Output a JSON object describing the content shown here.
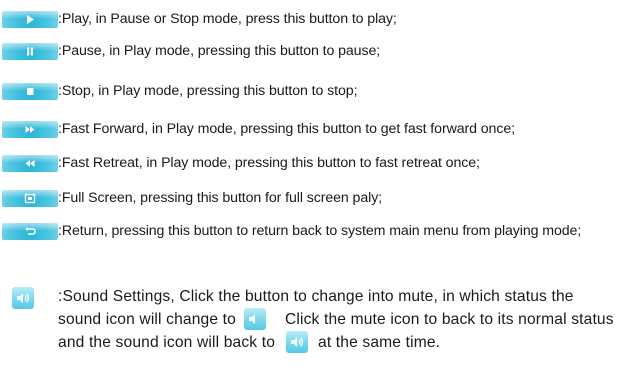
{
  "items": [
    {
      "icon": "play-icon",
      "text": ":Play, in Pause or Stop mode, press this button to play;"
    },
    {
      "icon": "pause-icon",
      "text": ":Pause, in Play mode, pressing this button to pause;"
    },
    {
      "icon": "stop-icon",
      "text": ":Stop, in Play mode, pressing this button to stop;"
    },
    {
      "icon": "fast-forward-icon",
      "text": ":Fast Forward, in Play mode, pressing this button to get fast forward once;"
    },
    {
      "icon": "fast-retreat-icon",
      "text": ":Fast Retreat, in Play mode, pressing this button to fast retreat once;"
    },
    {
      "icon": "full-screen-icon",
      "text": ":Full Screen, pressing this button for full screen paly;"
    },
    {
      "icon": "return-icon",
      "text": ":Return, pressing this button to return back to system main menu from playing mode;"
    }
  ],
  "sound": {
    "icon": "sound-icon",
    "mute_icon": "mute-icon",
    "part1": ":Sound Settings, Click the button to change into mute, in which status the sound icon will change to",
    "part2": "Click the mute icon to back to its normal status and the sound icon will back to",
    "part3": "at the same time."
  },
  "colors": {
    "button_gradient_start": "#6fd0e8",
    "button_gradient_mid": "#2bb6d9",
    "icon_glyph": "#ffffff",
    "text": "#1a1a1a"
  }
}
